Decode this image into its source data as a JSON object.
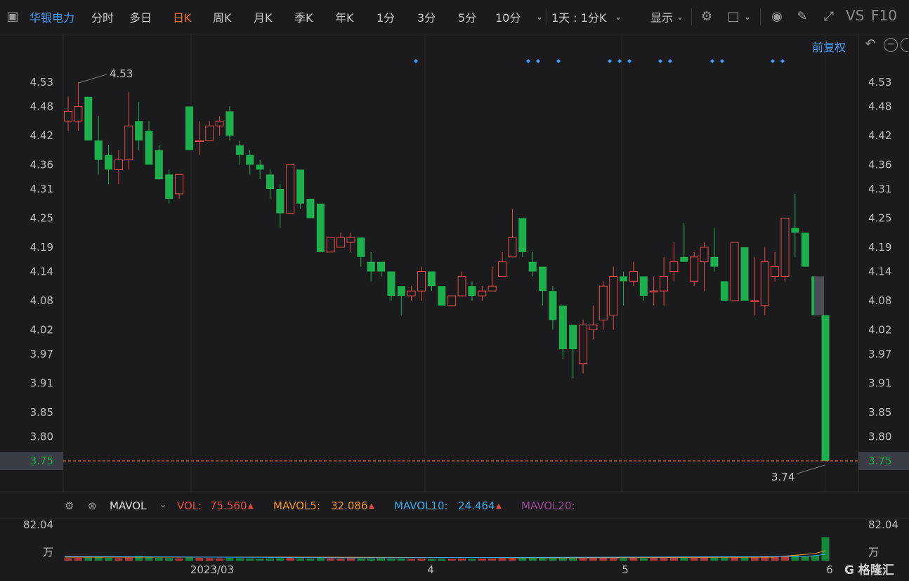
{
  "toolbar": {
    "stock_name": "华银电力",
    "tabs": [
      "分时",
      "多日",
      "日K",
      "周K",
      "月K",
      "季K",
      "年K",
      "1分",
      "3分",
      "5分",
      "10分"
    ],
    "active_tab": "日K",
    "interval": "1天 : 1分K",
    "display": "显示",
    "vs_label": "VS",
    "f10_label": "F10"
  },
  "adjust_label": "前复权",
  "price_axis": {
    "ticks": [
      "4.53",
      "4.48",
      "4.42",
      "4.36",
      "4.31",
      "4.25",
      "4.19",
      "4.14",
      "4.08",
      "4.02",
      "3.97",
      "3.91",
      "3.85",
      "3.80",
      "3.75"
    ],
    "current": "3.75",
    "max_label": "4.53",
    "min_label": "3.74"
  },
  "x_axis": {
    "labels": [
      "2023/03",
      "4",
      "5",
      "6"
    ]
  },
  "indicator": {
    "name": "MAVOL",
    "vol_label": "VOL:",
    "vol_value": "75.560",
    "mavol5_label": "MAVOL5:",
    "mavol5_value": "32.086",
    "mavol10_label": "MAVOL10:",
    "mavol10_value": "24.464",
    "mavol20_label": "MAVOL20:",
    "vol_axis_top": "82.04",
    "vol_axis_unit": "万"
  },
  "colors": {
    "up": "#e84a4a",
    "down": "#1fae4e",
    "accent": "#f0712c",
    "link": "#4a9df8"
  },
  "chart_data": {
    "type": "candlestick",
    "ylim": [
      3.72,
      4.56
    ],
    "candles": [
      {
        "o": 4.45,
        "h": 4.5,
        "l": 4.43,
        "c": 4.47
      },
      {
        "o": 4.45,
        "h": 4.53,
        "l": 4.43,
        "c": 4.48
      },
      {
        "o": 4.5,
        "h": 4.5,
        "l": 4.42,
        "c": 4.41
      },
      {
        "o": 4.41,
        "h": 4.46,
        "l": 4.34,
        "c": 4.37
      },
      {
        "o": 4.38,
        "h": 4.4,
        "l": 4.32,
        "c": 4.35
      },
      {
        "o": 4.35,
        "h": 4.39,
        "l": 4.32,
        "c": 4.37
      },
      {
        "o": 4.37,
        "h": 4.51,
        "l": 4.35,
        "c": 4.44
      },
      {
        "o": 4.45,
        "h": 4.49,
        "l": 4.39,
        "c": 4.41
      },
      {
        "o": 4.43,
        "h": 4.45,
        "l": 4.36,
        "c": 4.36
      },
      {
        "o": 4.39,
        "h": 4.4,
        "l": 4.33,
        "c": 4.33
      },
      {
        "o": 4.34,
        "h": 4.35,
        "l": 4.28,
        "c": 4.29
      },
      {
        "o": 4.3,
        "h": 4.34,
        "l": 4.29,
        "c": 4.34
      },
      {
        "o": 4.48,
        "h": 4.48,
        "l": 4.39,
        "c": 4.39
      },
      {
        "o": 4.41,
        "h": 4.45,
        "l": 4.38,
        "c": 4.41
      },
      {
        "o": 4.41,
        "h": 4.45,
        "l": 4.41,
        "c": 4.44
      },
      {
        "o": 4.44,
        "h": 4.46,
        "l": 4.42,
        "c": 4.45
      },
      {
        "o": 4.47,
        "h": 4.48,
        "l": 4.41,
        "c": 4.42
      },
      {
        "o": 4.4,
        "h": 4.41,
        "l": 4.36,
        "c": 4.38
      },
      {
        "o": 4.38,
        "h": 4.39,
        "l": 4.34,
        "c": 4.36
      },
      {
        "o": 4.36,
        "h": 4.37,
        "l": 4.33,
        "c": 4.35
      },
      {
        "o": 4.34,
        "h": 4.35,
        "l": 4.29,
        "c": 4.31
      },
      {
        "o": 4.31,
        "h": 4.32,
        "l": 4.23,
        "c": 4.26
      },
      {
        "o": 4.26,
        "h": 4.36,
        "l": 4.26,
        "c": 4.36
      },
      {
        "o": 4.35,
        "h": 4.35,
        "l": 4.27,
        "c": 4.28
      },
      {
        "o": 4.29,
        "h": 4.29,
        "l": 4.25,
        "c": 4.25
      },
      {
        "o": 4.28,
        "h": 4.28,
        "l": 4.18,
        "c": 4.18
      },
      {
        "o": 4.18,
        "h": 4.21,
        "l": 4.18,
        "c": 4.21
      },
      {
        "o": 4.19,
        "h": 4.22,
        "l": 4.19,
        "c": 4.21
      },
      {
        "o": 4.2,
        "h": 4.22,
        "l": 4.18,
        "c": 4.21
      },
      {
        "o": 4.21,
        "h": 4.21,
        "l": 4.15,
        "c": 4.17
      },
      {
        "o": 4.16,
        "h": 4.18,
        "l": 4.12,
        "c": 4.14
      },
      {
        "o": 4.16,
        "h": 4.16,
        "l": 4.13,
        "c": 4.14
      },
      {
        "o": 4.14,
        "h": 4.14,
        "l": 4.08,
        "c": 4.09
      },
      {
        "o": 4.11,
        "h": 4.11,
        "l": 4.05,
        "c": 4.09
      },
      {
        "o": 4.09,
        "h": 4.11,
        "l": 4.08,
        "c": 4.1
      },
      {
        "o": 4.1,
        "h": 4.15,
        "l": 4.08,
        "c": 4.14
      },
      {
        "o": 4.14,
        "h": 4.14,
        "l": 4.1,
        "c": 4.11
      },
      {
        "o": 4.11,
        "h": 4.11,
        "l": 4.07,
        "c": 4.07
      },
      {
        "o": 4.07,
        "h": 4.09,
        "l": 4.07,
        "c": 4.09
      },
      {
        "o": 4.09,
        "h": 4.14,
        "l": 4.09,
        "c": 4.13
      },
      {
        "o": 4.11,
        "h": 4.12,
        "l": 4.08,
        "c": 4.09
      },
      {
        "o": 4.09,
        "h": 4.11,
        "l": 4.08,
        "c": 4.1
      },
      {
        "o": 4.1,
        "h": 4.15,
        "l": 4.1,
        "c": 4.11
      },
      {
        "o": 4.13,
        "h": 4.18,
        "l": 4.13,
        "c": 4.16
      },
      {
        "o": 4.17,
        "h": 4.27,
        "l": 4.17,
        "c": 4.21
      },
      {
        "o": 4.25,
        "h": 4.25,
        "l": 4.17,
        "c": 4.18
      },
      {
        "o": 4.16,
        "h": 4.18,
        "l": 4.13,
        "c": 4.14
      },
      {
        "o": 4.15,
        "h": 4.15,
        "l": 4.07,
        "c": 4.1
      },
      {
        "o": 4.1,
        "h": 4.11,
        "l": 4.02,
        "c": 4.04
      },
      {
        "o": 4.07,
        "h": 4.07,
        "l": 3.96,
        "c": 3.98
      },
      {
        "o": 4.03,
        "h": 4.03,
        "l": 3.92,
        "c": 3.98
      },
      {
        "o": 3.95,
        "h": 4.04,
        "l": 3.93,
        "c": 4.03
      },
      {
        "o": 4.02,
        "h": 4.07,
        "l": 4.0,
        "c": 4.03
      },
      {
        "o": 4.04,
        "h": 4.12,
        "l": 4.02,
        "c": 4.11
      },
      {
        "o": 4.05,
        "h": 4.15,
        "l": 4.02,
        "c": 4.13
      },
      {
        "o": 4.13,
        "h": 4.14,
        "l": 4.07,
        "c": 4.12
      },
      {
        "o": 4.12,
        "h": 4.16,
        "l": 4.11,
        "c": 4.14
      },
      {
        "o": 4.13,
        "h": 4.13,
        "l": 4.08,
        "c": 4.09
      },
      {
        "o": 4.1,
        "h": 4.13,
        "l": 4.07,
        "c": 4.1
      },
      {
        "o": 4.1,
        "h": 4.17,
        "l": 4.07,
        "c": 4.13
      },
      {
        "o": 4.14,
        "h": 4.2,
        "l": 4.12,
        "c": 4.16
      },
      {
        "o": 4.17,
        "h": 4.24,
        "l": 4.16,
        "c": 4.16
      },
      {
        "o": 4.12,
        "h": 4.18,
        "l": 4.11,
        "c": 4.17
      },
      {
        "o": 4.16,
        "h": 4.2,
        "l": 4.1,
        "c": 4.19
      },
      {
        "o": 4.17,
        "h": 4.23,
        "l": 4.14,
        "c": 4.15
      },
      {
        "o": 4.12,
        "h": 4.12,
        "l": 4.08,
        "c": 4.08
      },
      {
        "o": 4.08,
        "h": 4.2,
        "l": 4.08,
        "c": 4.2
      },
      {
        "o": 4.19,
        "h": 4.19,
        "l": 4.08,
        "c": 4.08
      },
      {
        "o": 4.08,
        "h": 4.17,
        "l": 4.05,
        "c": 4.08
      },
      {
        "o": 4.07,
        "h": 4.19,
        "l": 4.05,
        "c": 4.16
      },
      {
        "o": 4.13,
        "h": 4.18,
        "l": 4.12,
        "c": 4.15
      },
      {
        "o": 4.13,
        "h": 4.25,
        "l": 4.12,
        "c": 4.25
      },
      {
        "o": 4.23,
        "h": 4.3,
        "l": 4.17,
        "c": 4.22
      },
      {
        "o": 4.22,
        "h": 4.22,
        "l": 4.15,
        "c": 4.15
      },
      {
        "o": 4.13,
        "h": 4.13,
        "l": 4.05,
        "c": 4.05
      },
      {
        "o": 4.05,
        "h": 4.05,
        "l": 3.75,
        "c": 3.75
      }
    ],
    "volumes": [
      0.8,
      0.9,
      1.0,
      1.2,
      0.9,
      0.8,
      1.0,
      1.5,
      1.2,
      0.9,
      0.8,
      0.7,
      1.0,
      0.9,
      0.8,
      0.7,
      0.9,
      0.8,
      0.7,
      0.6,
      0.7,
      0.8,
      0.9,
      0.7,
      0.6,
      0.8,
      0.7,
      0.6,
      0.7,
      0.6,
      0.6,
      0.7,
      0.6,
      0.6,
      0.5,
      0.6,
      0.5,
      0.6,
      0.5,
      0.6,
      0.5,
      0.6,
      0.6,
      0.8,
      0.9,
      1.0,
      0.8,
      0.8,
      0.9,
      1.0,
      0.9,
      0.8,
      0.8,
      0.9,
      1.0,
      0.8,
      0.9,
      0.8,
      0.9,
      1.0,
      1.1,
      1.1,
      1.0,
      1.2,
      1.0,
      1.0,
      1.3,
      1.2,
      1.1,
      1.5,
      1.3,
      1.6,
      1.9,
      1.3,
      1.7,
      7.6
    ]
  }
}
